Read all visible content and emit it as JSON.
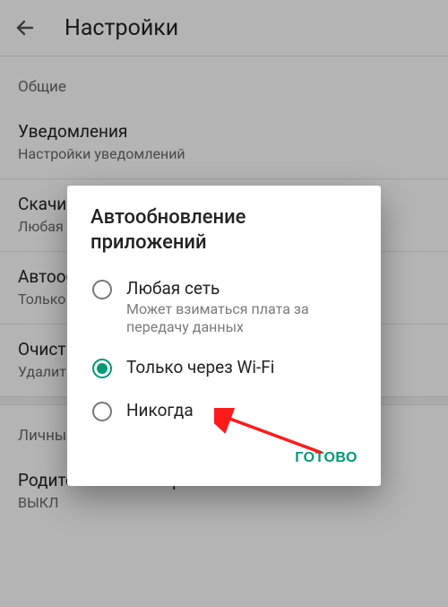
{
  "header": {
    "title": "Настройки"
  },
  "sections": {
    "general": {
      "label": "Общие",
      "notifications": {
        "title": "Уведомления",
        "sub": "Настройки уведомлений"
      },
      "downloads": {
        "title": "Скачивание приложений",
        "sub": "Любая сеть"
      },
      "autoupdate": {
        "title": "Автообновление приложений",
        "sub": "Только через Wi-Fi"
      },
      "clear_history": {
        "title": "Очистить историю поиска",
        "sub": "Удалить все поисковые запросы с устройства"
      }
    },
    "personal": {
      "label": "Личные",
      "parental": {
        "title": "Родительский контроль",
        "sub": "ВЫКЛ"
      }
    }
  },
  "dialog": {
    "title": "Автообновление приложений",
    "options": [
      {
        "label": "Любая сеть",
        "sub": "Может взиматься плата за передачу данных",
        "selected": false
      },
      {
        "label": "Только через Wi-Fi",
        "sub": "",
        "selected": true
      },
      {
        "label": "Никогда",
        "sub": "",
        "selected": false
      }
    ],
    "done": "ГОТОВО"
  }
}
